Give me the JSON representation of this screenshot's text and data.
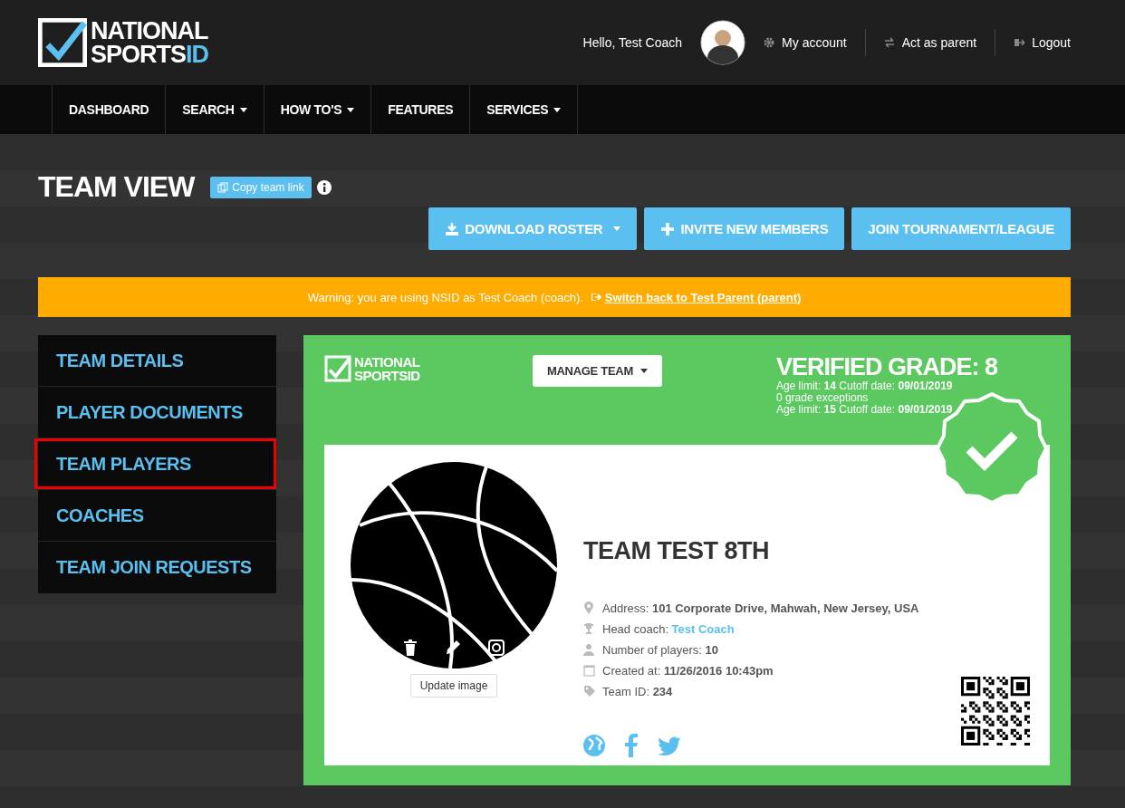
{
  "header": {
    "logo": {
      "line1": "NATIONAL",
      "line2": "SPORTS",
      "line2_accent": "ID"
    },
    "greeting": "Hello, Test Coach",
    "links": [
      {
        "label": "My account",
        "kind": "gear"
      },
      {
        "label": "Act as parent",
        "kind": "swap"
      },
      {
        "label": "Logout",
        "kind": "logout"
      }
    ]
  },
  "nav": [
    {
      "label": "DASHBOARD",
      "dropdown": false
    },
    {
      "label": "SEARCH",
      "dropdown": true
    },
    {
      "label": "HOW TO'S",
      "dropdown": true
    },
    {
      "label": "FEATURES",
      "dropdown": false
    },
    {
      "label": "SERVICES",
      "dropdown": true
    }
  ],
  "page": {
    "title": "TEAM VIEW",
    "copy_button": "Copy team link"
  },
  "actions": [
    {
      "label": "DOWNLOAD ROSTER",
      "kind": "download"
    },
    {
      "label": "INVITE NEW MEMBERS",
      "kind": "plus"
    },
    {
      "label": "JOIN TOURNAMENT/LEAGUE",
      "kind": "plain"
    }
  ],
  "warning": {
    "text": "Warning: you are using NSID as Test Coach (coach).",
    "link": "Switch back to Test Parent (parent)"
  },
  "sidebar": {
    "items": [
      {
        "label": "TEAM DETAILS",
        "highlighted": false
      },
      {
        "label": "PLAYER DOCUMENTS",
        "highlighted": false
      },
      {
        "label": "TEAM PLAYERS",
        "highlighted": true
      },
      {
        "label": "COACHES",
        "highlighted": false
      },
      {
        "label": "TEAM JOIN REQUESTS",
        "highlighted": false
      }
    ]
  },
  "team_card": {
    "logo": {
      "line1": "NATIONAL",
      "line2": "SPORTSID"
    },
    "manage_button": "MANAGE TEAM",
    "verified": {
      "title": "VERIFIED GRADE: 8",
      "lines": [
        "Age limit: **14** Cutoff date: **09/01/2019**",
        "0 grade exceptions",
        "Age limit: **15** Cutoff date: **09/01/2019**"
      ]
    },
    "update_image_button": "Update image",
    "name": "TEAM TEST 8TH",
    "details": [
      {
        "kind": "address",
        "label": "Address:",
        "value": "101 Corporate Drive, Mahwah, New Jersey, USA",
        "link": false
      },
      {
        "kind": "coach",
        "label": "Head coach:",
        "value": "Test Coach",
        "link": true
      },
      {
        "kind": "players",
        "label": "Number of players:",
        "value": "10",
        "link": false
      },
      {
        "kind": "created",
        "label": "Created at:",
        "value": "11/26/2016 10:43pm",
        "link": false
      },
      {
        "kind": "id",
        "label": "Team ID:",
        "value": "234",
        "link": false
      }
    ]
  }
}
